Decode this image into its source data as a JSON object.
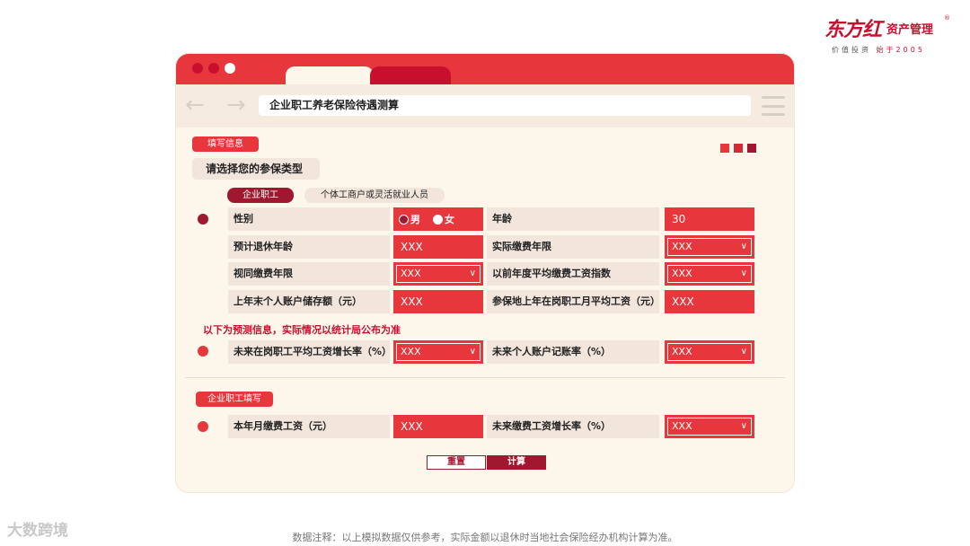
{
  "brand": {
    "name_script": "东方红",
    "name_sub": "资产管理",
    "registered": "®",
    "slogan_prefix": "价值投资",
    "slogan_suffix": "始于2005"
  },
  "browser": {
    "address_title": "企业职工养老保险待遇测算"
  },
  "section1": {
    "label": "填写信息",
    "question": "请选择您的参保类型",
    "type_options": [
      "企业职工",
      "个体工商户或灵活就业人员"
    ],
    "selected_type": "企业职工",
    "rows": [
      {
        "left_label": "性别",
        "gender_options": [
          "男",
          "女"
        ],
        "gender_selected": "男",
        "right_label": "年龄",
        "right_value": "30"
      },
      {
        "left_label": "预计退休年龄",
        "left_value": "XXX",
        "right_label": "实际缴费年限",
        "right_value": "XXX"
      },
      {
        "left_label": "视同缴费年限",
        "left_value": "XXX",
        "right_label": "以前年度平均缴费工资指数",
        "right_value": "XXX"
      },
      {
        "left_label": "上年末个人账户储存额（元）",
        "left_value": "XXX",
        "right_label": "参保地上年在岗职工月平均工资（元）",
        "right_value": "XXX"
      }
    ]
  },
  "forecast": {
    "notice": "以下为预测信息，实际情况以统计局公布为准",
    "left_label": "未来在岗职工平均工资增长率（%）",
    "left_value": "XXX",
    "right_label": "未来个人账户记账率（%）",
    "right_value": "XXX"
  },
  "section2": {
    "label": "企业职工填写",
    "left_label": "本年月缴费工资（元）",
    "left_value": "XXX",
    "right_label": "未来缴费工资增长率（%）",
    "right_value": "XXX"
  },
  "buttons": {
    "reset": "重置",
    "calculate": "计算"
  },
  "footnote": "数据注释：以上模拟数据仅供参考，实际金额以退休时当地社会保险经办机构计算为准。",
  "watermark": "大数跨境",
  "colors": {
    "primary_red": "#e8373c",
    "dark_red": "#a01830",
    "panel_bg": "#fdf6ea",
    "label_bg": "#f1e5dc"
  }
}
